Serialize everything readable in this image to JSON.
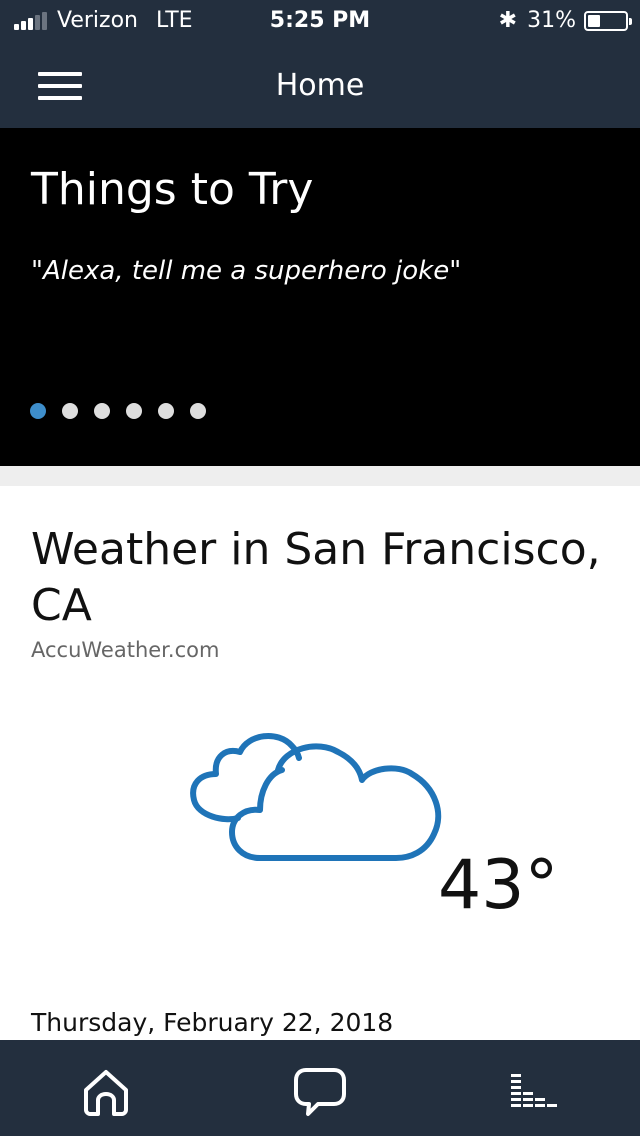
{
  "status_bar": {
    "carrier": "Verizon",
    "network": "LTE",
    "time": "5:25 PM",
    "battery": "31%"
  },
  "header": {
    "title": "Home"
  },
  "things_to_try": {
    "title": "Things to Try",
    "quote": "\"Alexa, tell me a superhero joke\"",
    "pages": 6,
    "active_page": 1
  },
  "weather": {
    "title": "Weather in San Francisco, CA",
    "source": "AccuWeather.com",
    "temperature": "43°",
    "date": "Thursday, February 22, 2018",
    "condition_icon": "cloudy-icon"
  },
  "tab_bar": {
    "items": [
      "home-icon",
      "chat-bubble-icon",
      "now-playing-icon"
    ]
  },
  "colors": {
    "nav_bg": "#232f3e",
    "accent": "#3e8ecb",
    "cloud_stroke": "#1f74b8"
  }
}
